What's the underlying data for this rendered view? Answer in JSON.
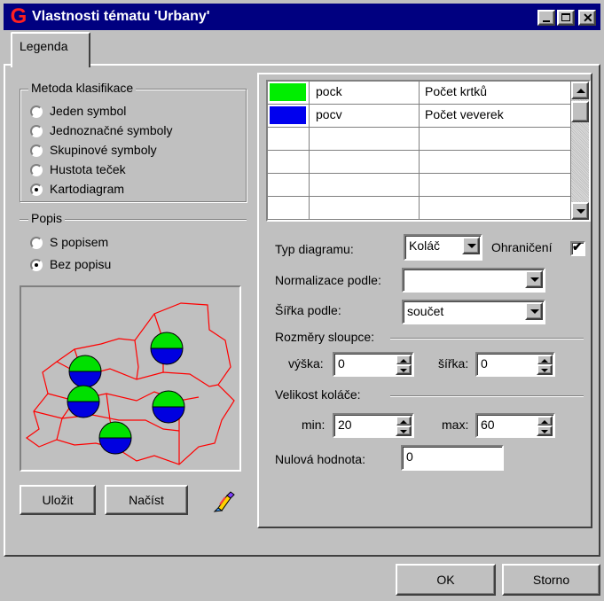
{
  "window": {
    "title": "Vlastnosti tématu 'Urbany'",
    "logo_letter": "G",
    "colors": {
      "titlebar": "#000080",
      "logo": "#ff2020"
    }
  },
  "tabs": [
    {
      "label": "Legenda",
      "active": true
    }
  ],
  "classification": {
    "group_label": "Metoda klasifikace",
    "options": [
      {
        "label": "Jeden symbol",
        "checked": false
      },
      {
        "label": "Jednoznačné symboly",
        "checked": false
      },
      {
        "label": "Skupinové symboly",
        "checked": false
      },
      {
        "label": "Hustota teček",
        "checked": false
      },
      {
        "label": "Kartodiagram",
        "checked": true
      }
    ]
  },
  "labeling": {
    "group_label": "Popis",
    "options": [
      {
        "label": "S popisem",
        "checked": false
      },
      {
        "label": "Bez popisu",
        "checked": true
      }
    ]
  },
  "preview_colors": {
    "top": "#00e000",
    "bottom": "#0000e0",
    "border": "#ff0000"
  },
  "buttons": {
    "save": "Uložit",
    "load": "Načíst",
    "ok": "OK",
    "cancel": "Storno"
  },
  "fields_table": {
    "rows": [
      {
        "color": "#00ee00",
        "field": "pock",
        "label": "Počet krtků"
      },
      {
        "color": "#0000ee",
        "field": "pocv",
        "label": "Počet veverek"
      },
      {
        "color": "",
        "field": "",
        "label": ""
      },
      {
        "color": "",
        "field": "",
        "label": ""
      },
      {
        "color": "",
        "field": "",
        "label": ""
      },
      {
        "color": "",
        "field": "",
        "label": ""
      }
    ]
  },
  "diagram": {
    "type_label": "Typ diagramu:",
    "type_value": "Koláč",
    "border_label": "Ohraničení",
    "border_checked": true,
    "normalize_label": "Normalizace podle:",
    "normalize_value": "",
    "width_by_label": "Šířka podle:",
    "width_by_value": "součet",
    "column_dims_label": "Rozměry sloupce:",
    "height_label": "výška:",
    "height_value": "0",
    "width_label": "šířka:",
    "width_value": "0",
    "pie_size_label": "Velikost koláče:",
    "min_label": "min:",
    "min_value": "20",
    "max_label": "max:",
    "max_value": "60",
    "null_label": "Nulová hodnota:",
    "null_value": "0"
  }
}
